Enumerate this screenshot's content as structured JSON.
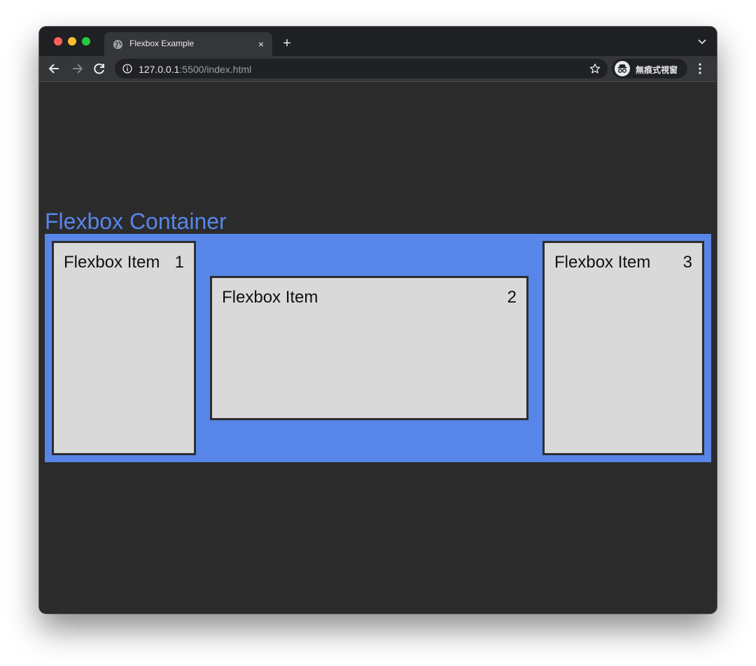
{
  "browser": {
    "tab": {
      "title": "Flexbox Example",
      "close_glyph": "×",
      "favicon": "globe-icon"
    },
    "new_tab_glyph": "+",
    "url": {
      "host": "127.0.0.1",
      "rest": ":5500/index.html"
    },
    "profile": {
      "label": "無痕式視窗",
      "icon": "incognito-icon"
    },
    "icons": [
      "back-arrow-icon",
      "forward-arrow-icon",
      "reload-icon",
      "info-icon",
      "star-icon",
      "more-vert-icon",
      "chevron-down-icon"
    ]
  },
  "page": {
    "container_title": "Flexbox Container",
    "items": [
      {
        "label": "Flexbox Item",
        "number": "1"
      },
      {
        "label": "Flexbox Item",
        "number": "2"
      },
      {
        "label": "Flexbox Item",
        "number": "3"
      }
    ]
  },
  "colors": {
    "accent": "#5886e8",
    "item_bg": "#d9d9d9",
    "page_bg": "#2b2b2c",
    "toolbar_bg": "#35363a",
    "tabstrip_bg": "#1f2023"
  }
}
